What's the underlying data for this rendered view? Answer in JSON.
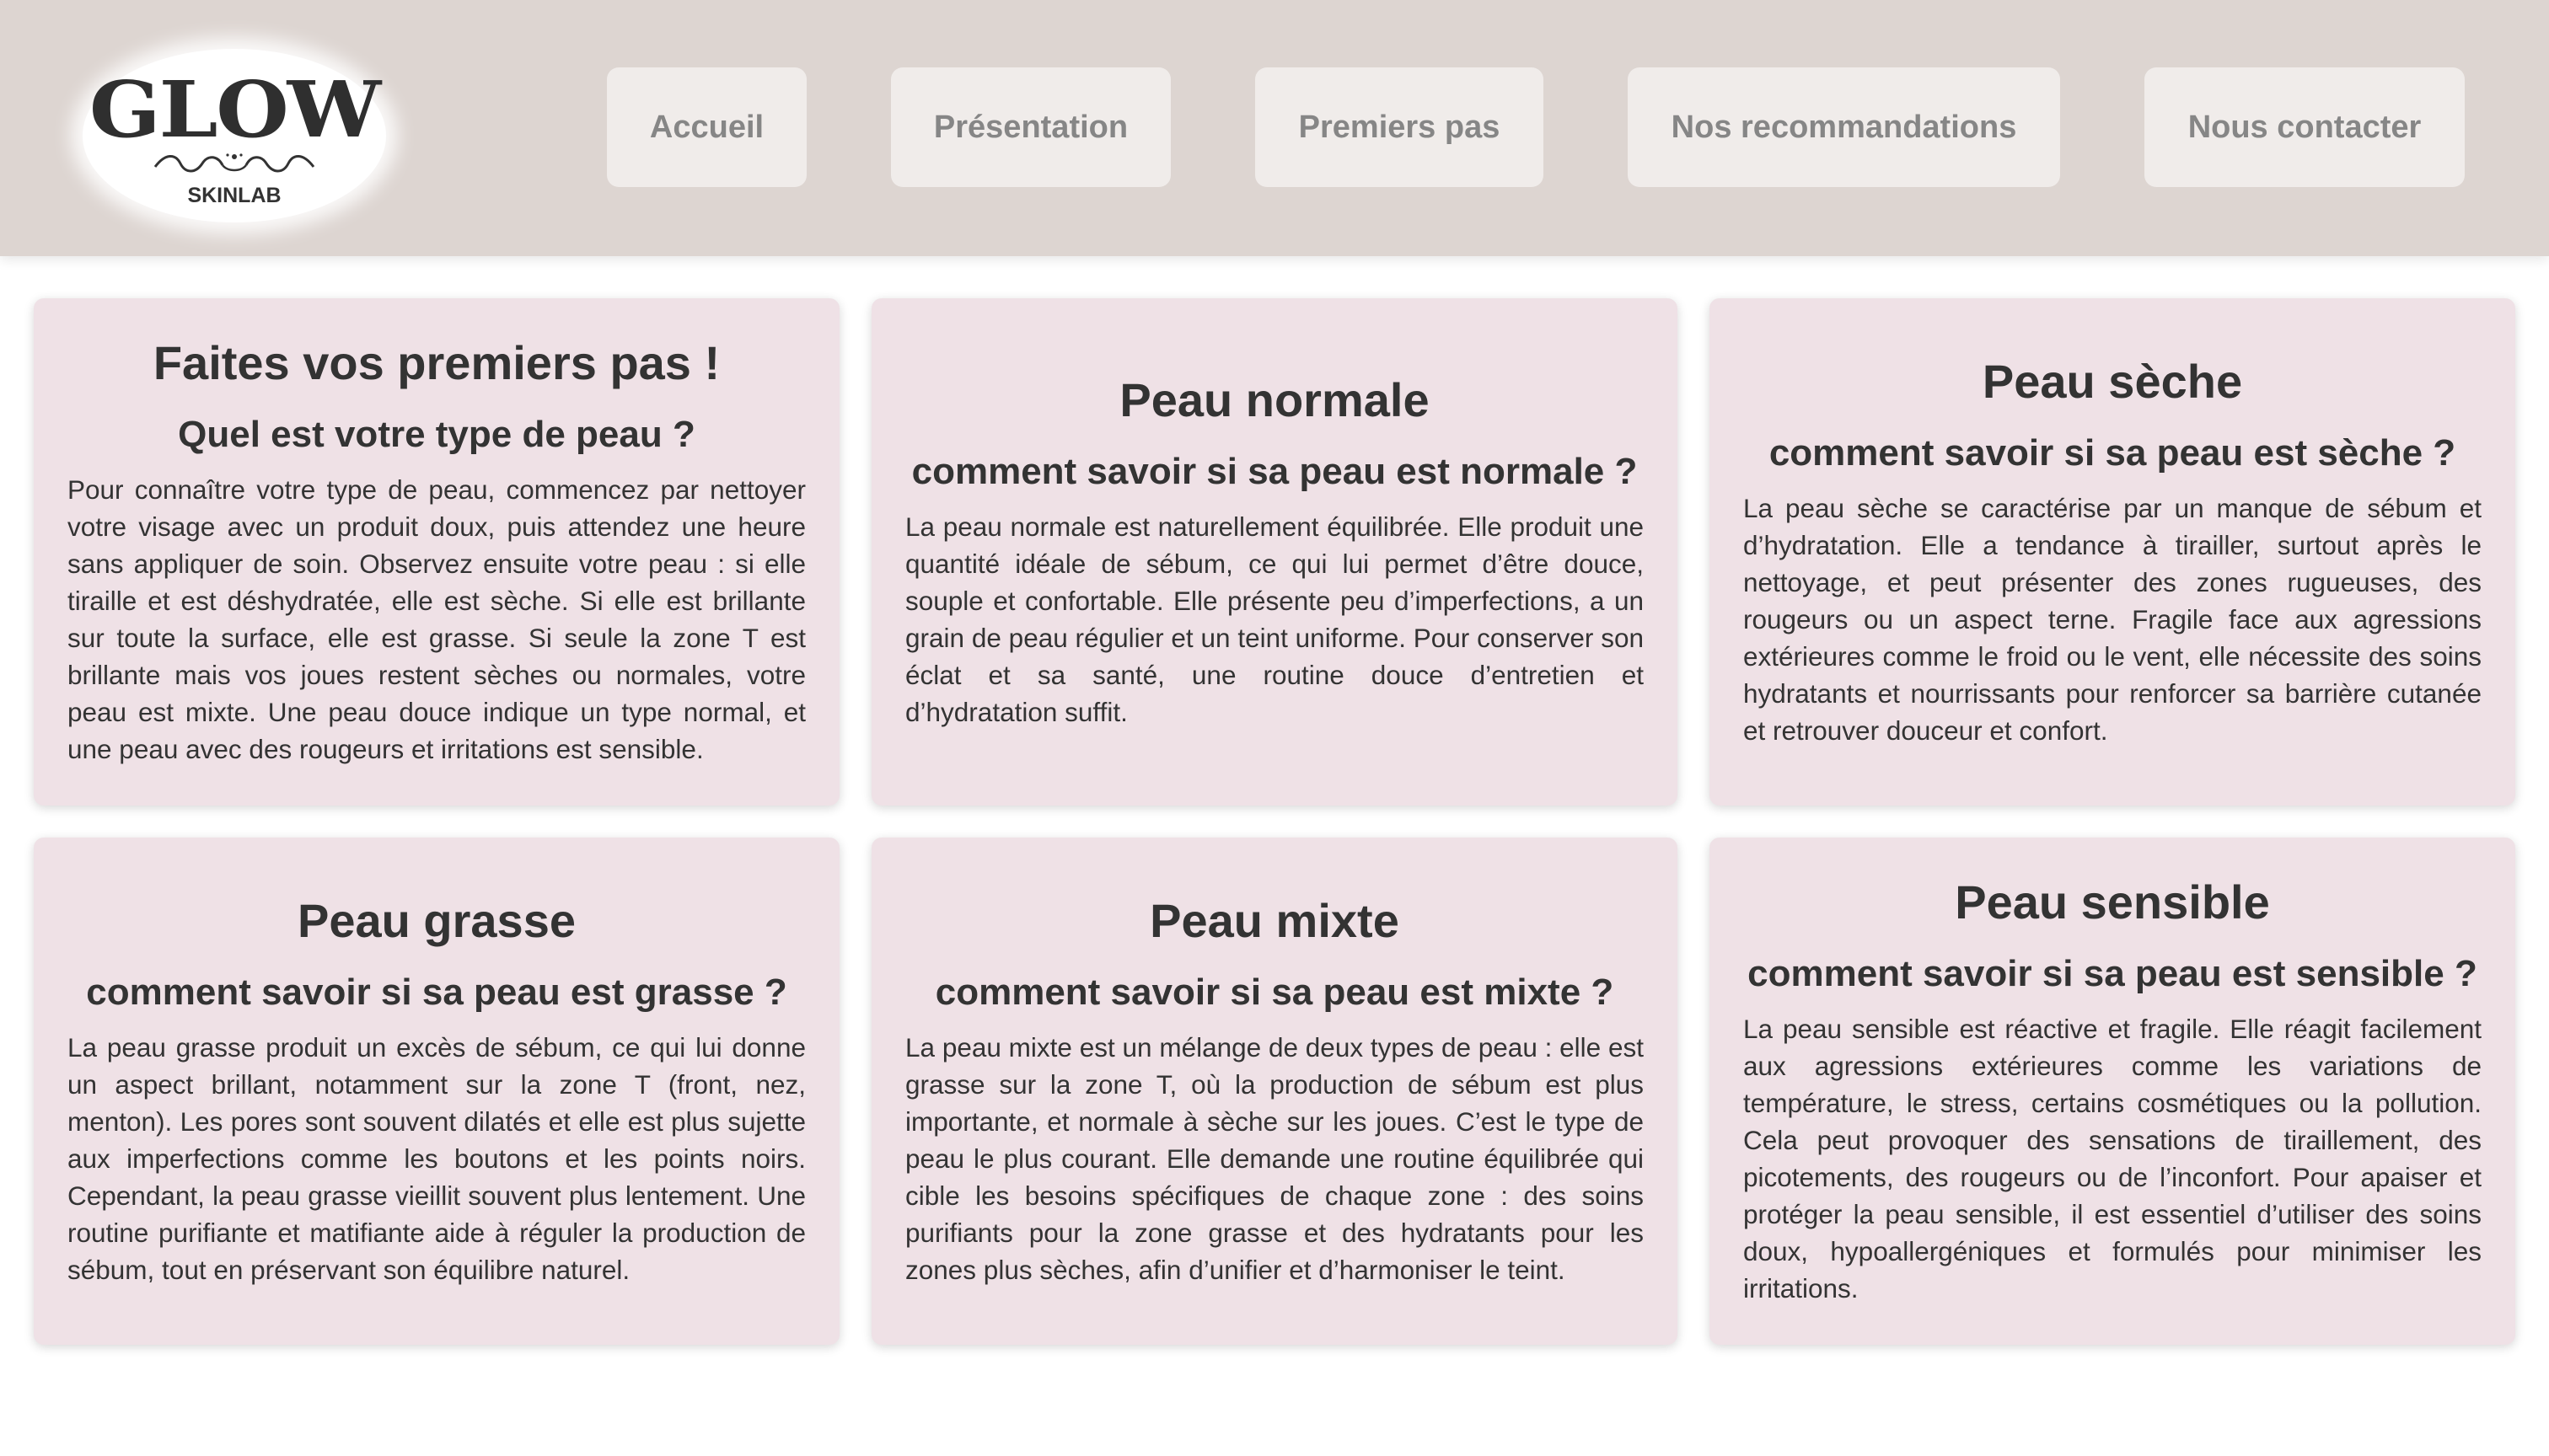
{
  "logo": {
    "word": "GLOW",
    "sub": "SKINLAB"
  },
  "nav": [
    {
      "label": "Accueil"
    },
    {
      "label": "Présentation"
    },
    {
      "label": "Premiers pas"
    },
    {
      "label": "Nos recommandations"
    },
    {
      "label": "Nous contacter"
    }
  ],
  "cards": [
    {
      "title": "Faites vos premiers pas !",
      "subtitle": "Quel est votre type de peau ?",
      "text": "Pour connaître votre type de peau, commencez par nettoyer votre visage avec un produit doux, puis attendez une heure sans appliquer de soin. Observez ensuite votre peau : si elle tiraille et est déshydratée, elle est sèche. Si elle est brillante sur toute la surface, elle est grasse. Si seule la zone T est brillante mais vos joues restent sèches ou normales, votre peau est mixte. Une peau douce indique un type normal, et une peau avec des rougeurs et irritations est sensible."
    },
    {
      "title": "Peau normale",
      "subtitle": "comment savoir si sa peau est normale ?",
      "text": "La peau normale est naturellement équilibrée. Elle produit une quantité idéale de sébum, ce qui lui permet d’être douce, souple et confortable. Elle présente peu d’imperfections, a un grain de peau régulier et un teint uniforme. Pour conserver son éclat et sa santé, une routine douce d’entretien et d’hydratation suffit."
    },
    {
      "title": "Peau sèche",
      "subtitle": "comment savoir si sa peau est sèche ?",
      "text": "La peau sèche se caractérise par un manque de sébum et d’hydratation. Elle a tendance à tirailler, surtout après le nettoyage, et peut présenter des zones rugueuses, des rougeurs ou un aspect terne. Fragile face aux agressions extérieures comme le froid ou le vent, elle nécessite des soins hydratants et nourrissants pour renforcer sa barrière cutanée et retrouver douceur et confort."
    },
    {
      "title": "Peau grasse",
      "subtitle": "comment savoir si sa peau est grasse ?",
      "text": "La peau grasse produit un excès de sébum, ce qui lui donne un aspect brillant, notamment sur la zone T (front, nez, menton). Les pores sont souvent dilatés et elle est plus sujette aux imperfections comme les boutons et les points noirs. Cependant, la peau grasse vieillit souvent plus lentement. Une routine purifiante et matifiante aide à réguler la production de sébum, tout en préservant son équilibre naturel."
    },
    {
      "title": "Peau mixte",
      "subtitle": "comment savoir si sa peau est mixte ?",
      "text": "La peau mixte est un mélange de deux types de peau : elle est grasse sur la zone T, où la production de sébum est plus importante, et normale à sèche sur les joues. C’est le type de peau le plus courant. Elle demande une routine équilibrée qui cible les besoins spécifiques de chaque zone : des soins purifiants pour la zone grasse et des hydratants pour les zones plus sèches, afin d’unifier et d’harmoniser le teint."
    },
    {
      "title": "Peau sensible",
      "subtitle": "comment savoir si sa peau est sensible ?",
      "text": "La peau sensible est réactive et fragile. Elle réagit facilement aux agressions extérieures comme les variations de température, le stress, certains cosmétiques ou la pollution. Cela peut provoquer des sensations de tiraillement, des picotements, des rougeurs ou de l’inconfort. Pour apaiser et protéger la peau sensible, il est essentiel d’utiliser des soins doux, hypoallergéniques et formulés pour minimiser les irritations."
    }
  ]
}
